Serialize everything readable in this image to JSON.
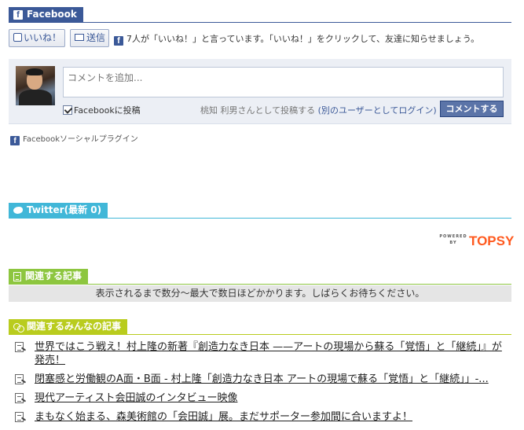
{
  "facebook": {
    "section_title": "Facebook",
    "like_label": "いいね！",
    "send_label": "送信",
    "like_count_text": "7人が「いいね！」と言っています。「いいね！」をクリックして、友達に知らせましょう。",
    "comment_placeholder": "コメントを追加...",
    "post_to_facebook_label": "Facebookに投稿",
    "posting_as_text": "桃知 利男さんとして投稿する",
    "switch_user_text": "(別のユーザーとしてログイン)",
    "comment_button": "コメントする",
    "social_plugin_text": "Facebookソーシャルプラグイン",
    "icon": "facebook-f-icon"
  },
  "twitter": {
    "section_title": "Twitter(最新 0)",
    "icon": "twitter-bird-icon",
    "topsy": {
      "powered": "POWERED",
      "by": "BY",
      "brand": "TOPSY"
    }
  },
  "related": {
    "section_title": "関連する記事",
    "icon": "document-icon",
    "message": "表示されるまで数分〜最大で数日ほどかかります。しばらくお待ちください。"
  },
  "everyone": {
    "section_title": "関連するみんなの記事",
    "icon": "people-icon",
    "items": [
      {
        "title": "世界ではこう戦え！村上隆の新著『創造力なき日本 ——アートの現場から蘇る「覚悟」と「継続」』が発売！"
      },
      {
        "title": "閉塞感と労働観のA面・B面 - 村上隆「創造力なき日本 アートの現場で蘇る「覚悟」と「継続」」-..."
      },
      {
        "title": "現代アーティスト会田誠のインタビュー映像"
      },
      {
        "title": "まもなく始まる、森美術館の「会田誠」展。まだサポーター参加間に合いますよ！"
      }
    ]
  },
  "colors": {
    "facebook": "#3b5998",
    "twitter": "#41b7d8",
    "related": "#8dc63f",
    "everyone": "#b9cc1e",
    "topsy": "#ff5a1f"
  }
}
